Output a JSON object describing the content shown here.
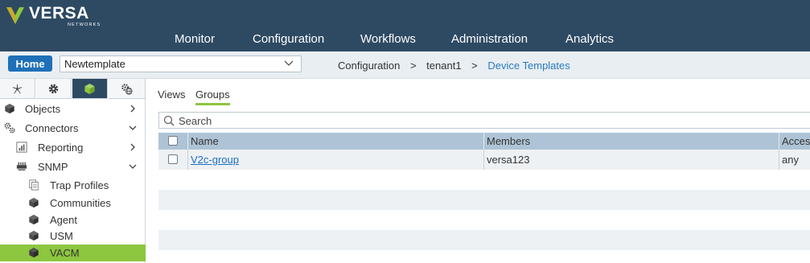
{
  "brand": {
    "name": "VERSA",
    "tagline": "NETWORKS"
  },
  "main_nav": [
    "Monitor",
    "Configuration",
    "Workflows",
    "Administration",
    "Analytics"
  ],
  "toolbar": {
    "home_label": "Home",
    "template_value": "Newtemplate"
  },
  "breadcrumb": {
    "items": [
      "Configuration",
      "tenant1",
      "Device Templates"
    ],
    "separator": ">"
  },
  "sidebar": {
    "tabs": [
      "topology-icon",
      "gear-icon",
      "cube-icon",
      "gear-globe-icon"
    ],
    "active_tab": 2,
    "items": [
      {
        "label": "Objects",
        "icon": "cube-icon",
        "arrow": "chevron-right"
      },
      {
        "label": "Connectors",
        "icon": "gears-icon",
        "arrow": "chevron-down"
      },
      {
        "label": "Reporting",
        "icon": "chart-icon",
        "arrow": "chevron-right"
      },
      {
        "label": "SNMP",
        "icon": "switch-icon",
        "arrow": "chevron-down"
      },
      {
        "label": "Trap Profiles",
        "icon": "document-icon"
      },
      {
        "label": "Communities",
        "icon": "cube-icon"
      },
      {
        "label": "Agent",
        "icon": "cube-icon"
      },
      {
        "label": "USM",
        "icon": "cube-icon"
      },
      {
        "label": "VACM",
        "icon": "cube-icon",
        "selected": true
      }
    ]
  },
  "content": {
    "tabs": [
      "Views",
      "Groups"
    ],
    "active_tab": "Groups",
    "search_placeholder": "Search",
    "columns": [
      "Name",
      "Members",
      "Access"
    ],
    "rows": [
      {
        "name": "V2c-group",
        "members": "versa123",
        "access": "any"
      }
    ]
  },
  "colors": {
    "header": "#2e4a63",
    "accent_green": "#8dc63f",
    "home_blue": "#1e70b8",
    "link_blue": "#1a6fc0"
  }
}
